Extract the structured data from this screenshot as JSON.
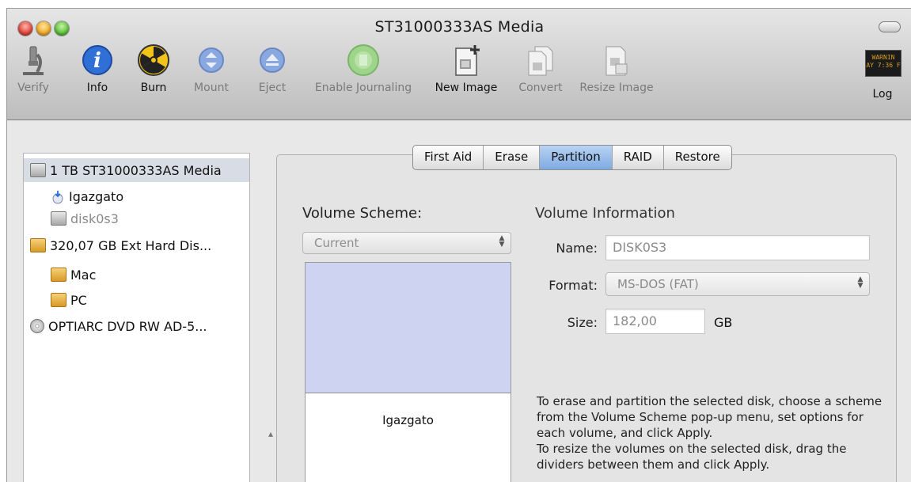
{
  "window": {
    "title": "ST31000333AS Media"
  },
  "toolbar": [
    {
      "label": "Verify",
      "icon": "microscope-icon",
      "enabled": false
    },
    {
      "label": "Info",
      "icon": "info-icon",
      "enabled": true
    },
    {
      "label": "Burn",
      "icon": "radiation-icon",
      "enabled": true
    },
    {
      "label": "Mount",
      "icon": "mount-icon",
      "enabled": false
    },
    {
      "label": "Eject",
      "icon": "eject-icon",
      "enabled": false
    },
    {
      "label": "Enable Journaling",
      "icon": "journaling-icon",
      "enabled": false
    },
    {
      "label": "New Image",
      "icon": "new-image-icon",
      "enabled": true
    },
    {
      "label": "Convert",
      "icon": "convert-icon",
      "enabled": false
    },
    {
      "label": "Resize Image",
      "icon": "resize-image-icon",
      "enabled": false
    },
    {
      "label": "Log",
      "icon": "log-icon",
      "enabled": true
    }
  ],
  "log_badge": "WARNIN\nAY 7:36 F",
  "sidebar": {
    "items": [
      {
        "label": "1 TB ST31000333AS Media",
        "icon": "hard-disk-icon",
        "level": 0,
        "selected": true
      },
      {
        "label": "Igazgato",
        "icon": "volume-icon",
        "level": 1
      },
      {
        "label": "disk0s3",
        "icon": "hard-disk-icon",
        "level": 1,
        "dim": true
      },
      {
        "label": "320,07 GB Ext Hard Dis...",
        "icon": "external-disk-icon",
        "level": 0
      },
      {
        "label": "Mac",
        "icon": "external-disk-icon",
        "level": 1
      },
      {
        "label": "PC",
        "icon": "external-disk-icon",
        "level": 1
      },
      {
        "label": "OPTIARC DVD RW AD-5...",
        "icon": "dvd-icon",
        "level": 0
      }
    ]
  },
  "tabs": [
    {
      "label": "First Aid",
      "active": false
    },
    {
      "label": "Erase",
      "active": false
    },
    {
      "label": "Partition",
      "active": true
    },
    {
      "label": "RAID",
      "active": false
    },
    {
      "label": "Restore",
      "active": false
    }
  ],
  "partition": {
    "volume_scheme_label": "Volume Scheme:",
    "scheme_value": "Current",
    "volume_name": "Igazgato",
    "volume_info_label": "Volume Information",
    "name_label": "Name:",
    "name_value": "DISK0S3",
    "format_label": "Format:",
    "format_value": "MS-DOS (FAT)",
    "size_label": "Size:",
    "size_value": "182,00",
    "size_unit": "GB",
    "help_1": "To erase and partition the selected disk, choose a scheme from the Volume Scheme pop-up menu, set options for each volume, and click Apply.",
    "help_2": "To resize the volumes on the selected disk, drag the dividers between them and click Apply."
  },
  "colors": {
    "selection": "#d8dce4",
    "partition_fill": "#cfd3f2",
    "active_tab": "#7eaae2"
  }
}
